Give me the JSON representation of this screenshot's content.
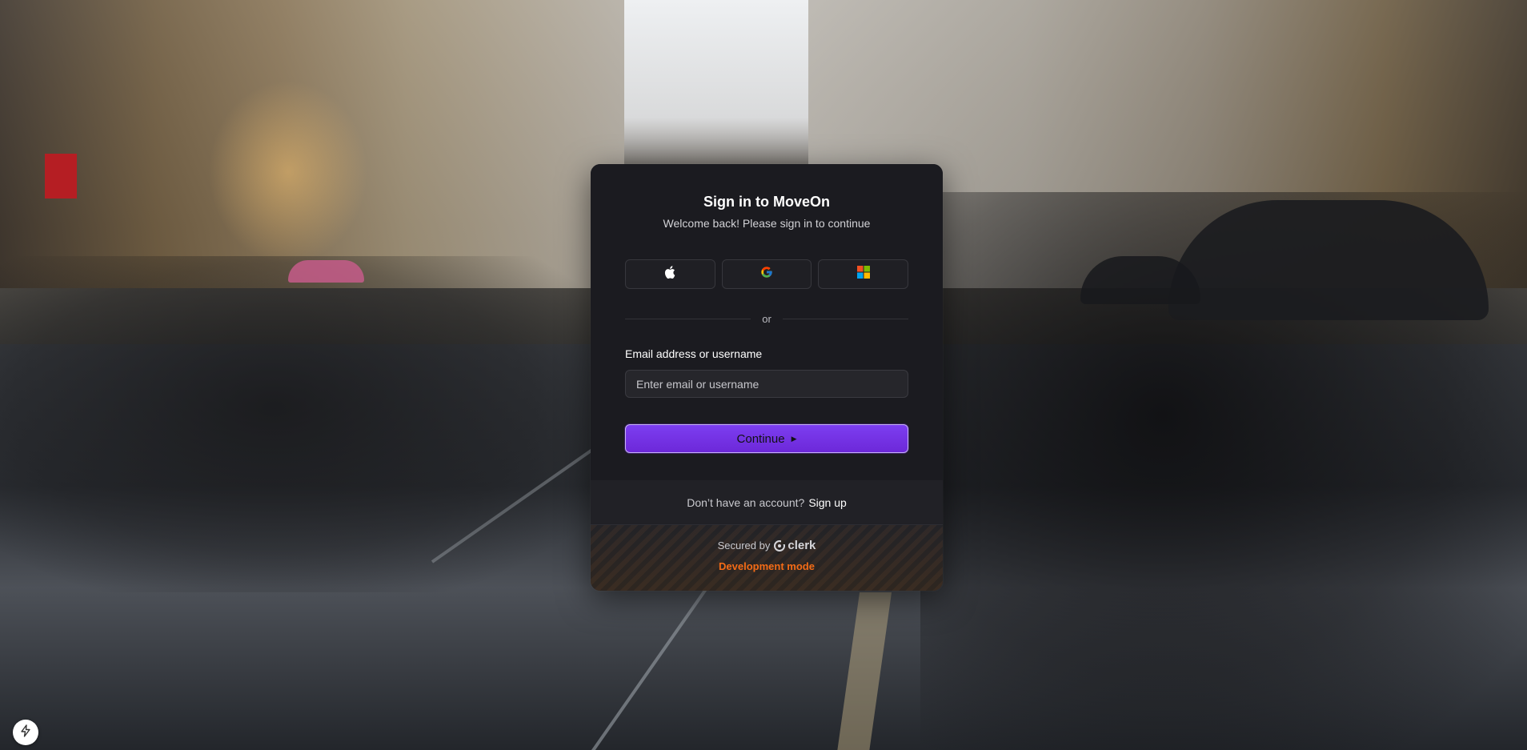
{
  "signin": {
    "title": "Sign in to MoveOn",
    "subtitle": "Welcome back! Please sign in to continue",
    "social": [
      {
        "provider": "Apple",
        "icon": "apple-icon"
      },
      {
        "provider": "Google",
        "icon": "google-icon"
      },
      {
        "provider": "Microsoft",
        "icon": "microsoft-icon"
      }
    ],
    "divider": "or",
    "email_label": "Email address or username",
    "email_placeholder": "Enter email or username",
    "email_value": "",
    "continue_label": "Continue",
    "continue_icon": "triangle-right-icon",
    "no_account_text": "Don’t have an account?",
    "signup_link": "Sign up",
    "secured_by": "Secured by",
    "clerk_brand": "clerk",
    "dev_mode": "Development mode"
  },
  "colors": {
    "card_bg": "#212126",
    "accent": "#6d28d9",
    "dev_mode": "#f36b16",
    "text": "#ffffff"
  },
  "floating": {
    "bolt_icon": "lightning-bolt-icon"
  }
}
